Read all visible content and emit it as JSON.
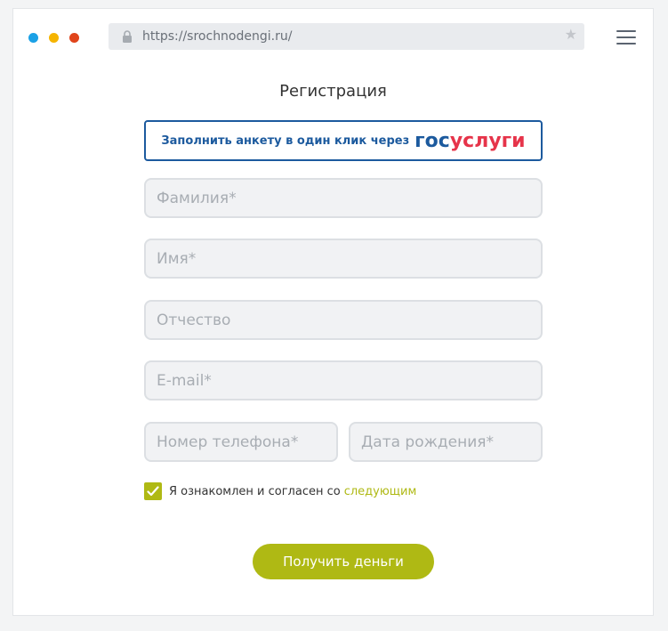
{
  "browser": {
    "url": "https://srochnodengi.ru/",
    "lock_icon": "lock-icon",
    "star_icon": "star-icon",
    "menu_icon": "hamburger-icon",
    "dot_colors": [
      "#1ba1e6",
      "#f5b400",
      "#e0441b"
    ]
  },
  "page": {
    "title": "Регистрация"
  },
  "gosuslugi": {
    "label": "Заполнить анкету в один клик через",
    "logo_part1": "гос",
    "logo_part2": "услуги",
    "logo_colors": [
      "#1c5a9e",
      "#e6344a"
    ]
  },
  "form": {
    "last_name_placeholder": "Фамилия*",
    "first_name_placeholder": "Имя*",
    "middle_name_placeholder": "Отчество",
    "email_placeholder": "E-mail*",
    "phone_placeholder": "Номер телефона*",
    "birthdate_placeholder": "Дата рождения*"
  },
  "agreement": {
    "checked": true,
    "text": "Я ознакомлен и согласен со",
    "link": "следующим"
  },
  "submit": {
    "label": "Получить деньги"
  },
  "colors": {
    "accent": "#afb914",
    "brand_blue": "#1c5a9e"
  }
}
